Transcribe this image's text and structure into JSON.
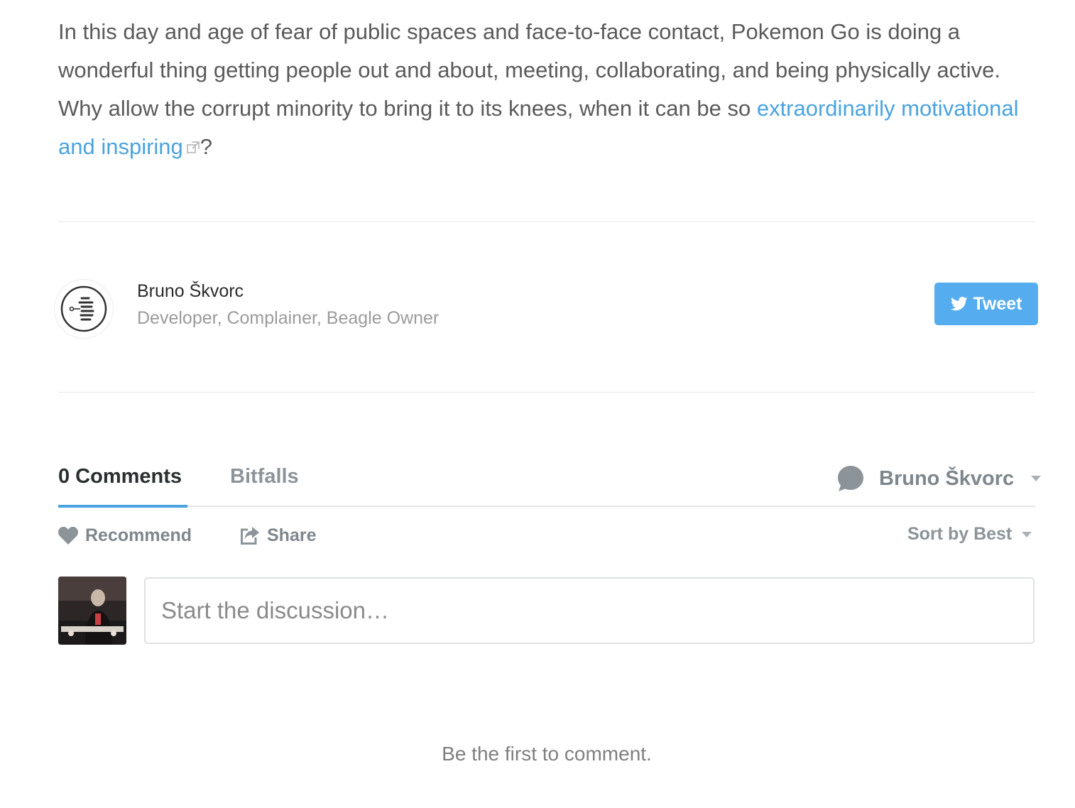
{
  "article": {
    "text_before_link": "In this day and age of fear of public spaces and face-to-face contact, Pokemon Go is doing a wonderful thing getting people out and about, meeting, collaborating, and being physically active. Why allow the corrupt minority to bring it to its knees, when it can be so ",
    "link_text": "extraordinarily motivational and inspiring",
    "text_after_link": "?"
  },
  "author": {
    "name": "Bruno Škvorc",
    "bio": "Developer, Complainer, Beagle Owner",
    "avatar_icon": "sitepoint-logo-icon"
  },
  "share": {
    "tweet_label": "Tweet",
    "tweet_icon": "twitter-bird-icon"
  },
  "comments": {
    "tabs": [
      {
        "label": "0 Comments",
        "active": true
      },
      {
        "label": "Bitfalls",
        "active": false
      }
    ],
    "user_menu": {
      "name": "Bruno Škvorc",
      "icon": "speech-bubble-icon"
    },
    "actions": {
      "recommend_label": "Recommend",
      "recommend_icon": "heart-icon",
      "share_label": "Share",
      "share_icon": "share-arrow-icon"
    },
    "sort_label": "Sort by Best",
    "input_placeholder": "Start the discussion…",
    "empty_message": "Be the first to comment."
  },
  "colors": {
    "link": "#4aa3df",
    "tweet_button": "#55acee",
    "active_tab_underline": "#4aa3df"
  }
}
